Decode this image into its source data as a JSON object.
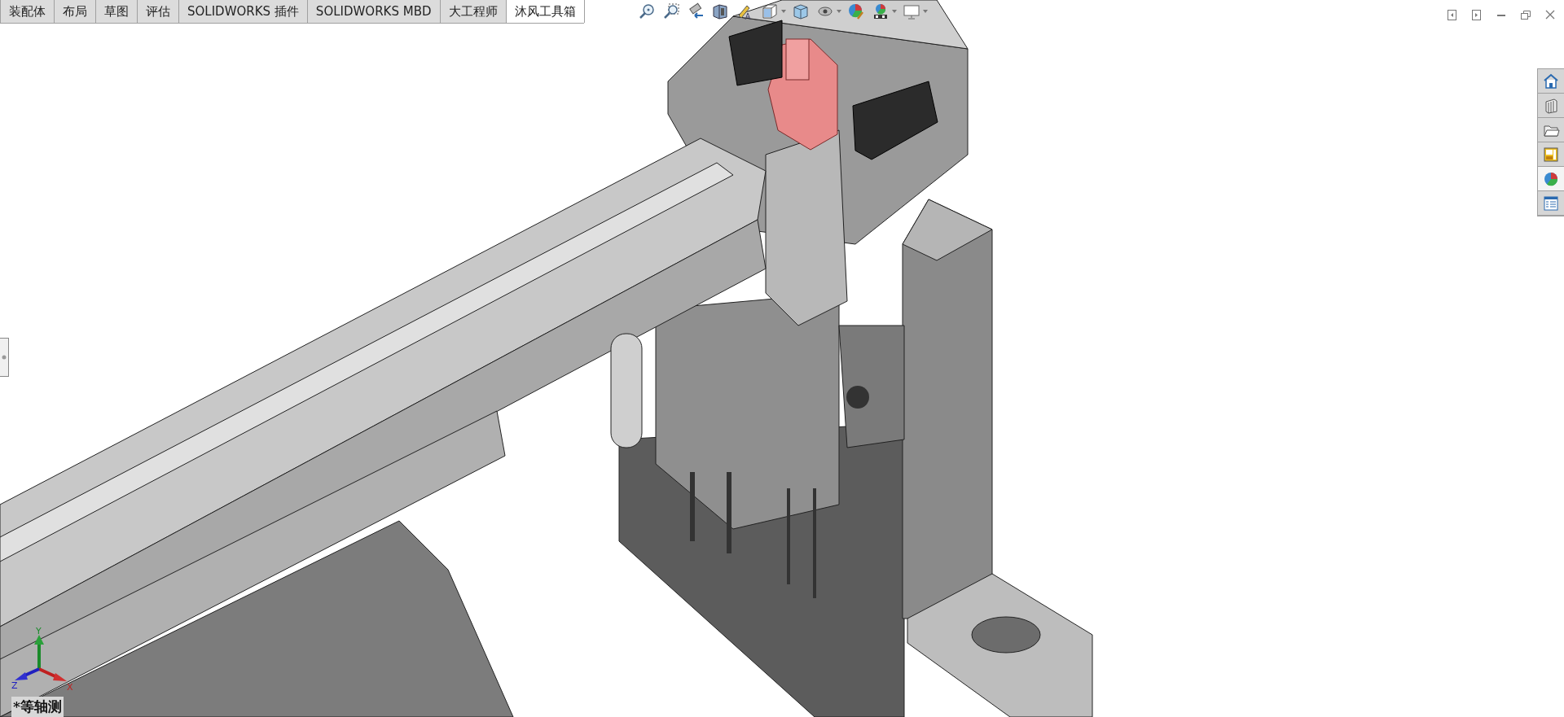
{
  "command_manager": {
    "tabs": [
      {
        "label": "装配体",
        "selected": false
      },
      {
        "label": "布局",
        "selected": false
      },
      {
        "label": "草图",
        "selected": false
      },
      {
        "label": "评估",
        "selected": false
      },
      {
        "label": "SOLIDWORKS 插件",
        "selected": false
      },
      {
        "label": "SOLIDWORKS MBD",
        "selected": false
      },
      {
        "label": "大工程师",
        "selected": false
      },
      {
        "label": "沐风工具箱",
        "selected": true
      }
    ]
  },
  "heads_up_toolbar": {
    "items": [
      {
        "kind": "zoom-fit",
        "dropdown": false
      },
      {
        "kind": "zoom-area",
        "dropdown": false
      },
      {
        "kind": "previous-view",
        "dropdown": false
      },
      {
        "kind": "section-view",
        "dropdown": false
      },
      {
        "kind": "dynamic-annotation",
        "dropdown": false
      },
      {
        "kind": "view-orientation",
        "dropdown": true
      },
      {
        "kind": "display-style",
        "dropdown": false
      },
      {
        "kind": "hide-show",
        "dropdown": true
      },
      {
        "kind": "edit-appearance",
        "dropdown": false
      },
      {
        "kind": "apply-scene",
        "dropdown": true
      },
      {
        "kind": "view-settings",
        "dropdown": true
      }
    ]
  },
  "window_controls": [
    {
      "kind": "tile-left"
    },
    {
      "kind": "tile-right"
    },
    {
      "kind": "minimize"
    },
    {
      "kind": "restore"
    },
    {
      "kind": "close"
    }
  ],
  "task_pane": {
    "items": [
      {
        "kind": "home",
        "selected": false
      },
      {
        "kind": "design-library",
        "selected": false
      },
      {
        "kind": "file-explorer",
        "selected": false
      },
      {
        "kind": "view-palette",
        "selected": false
      },
      {
        "kind": "appearances",
        "selected": true
      },
      {
        "kind": "custom-properties",
        "selected": false
      }
    ]
  },
  "triad": {
    "x_label": "X",
    "y_label": "Y",
    "z_label": "Z"
  },
  "view_label": "*等轴测"
}
